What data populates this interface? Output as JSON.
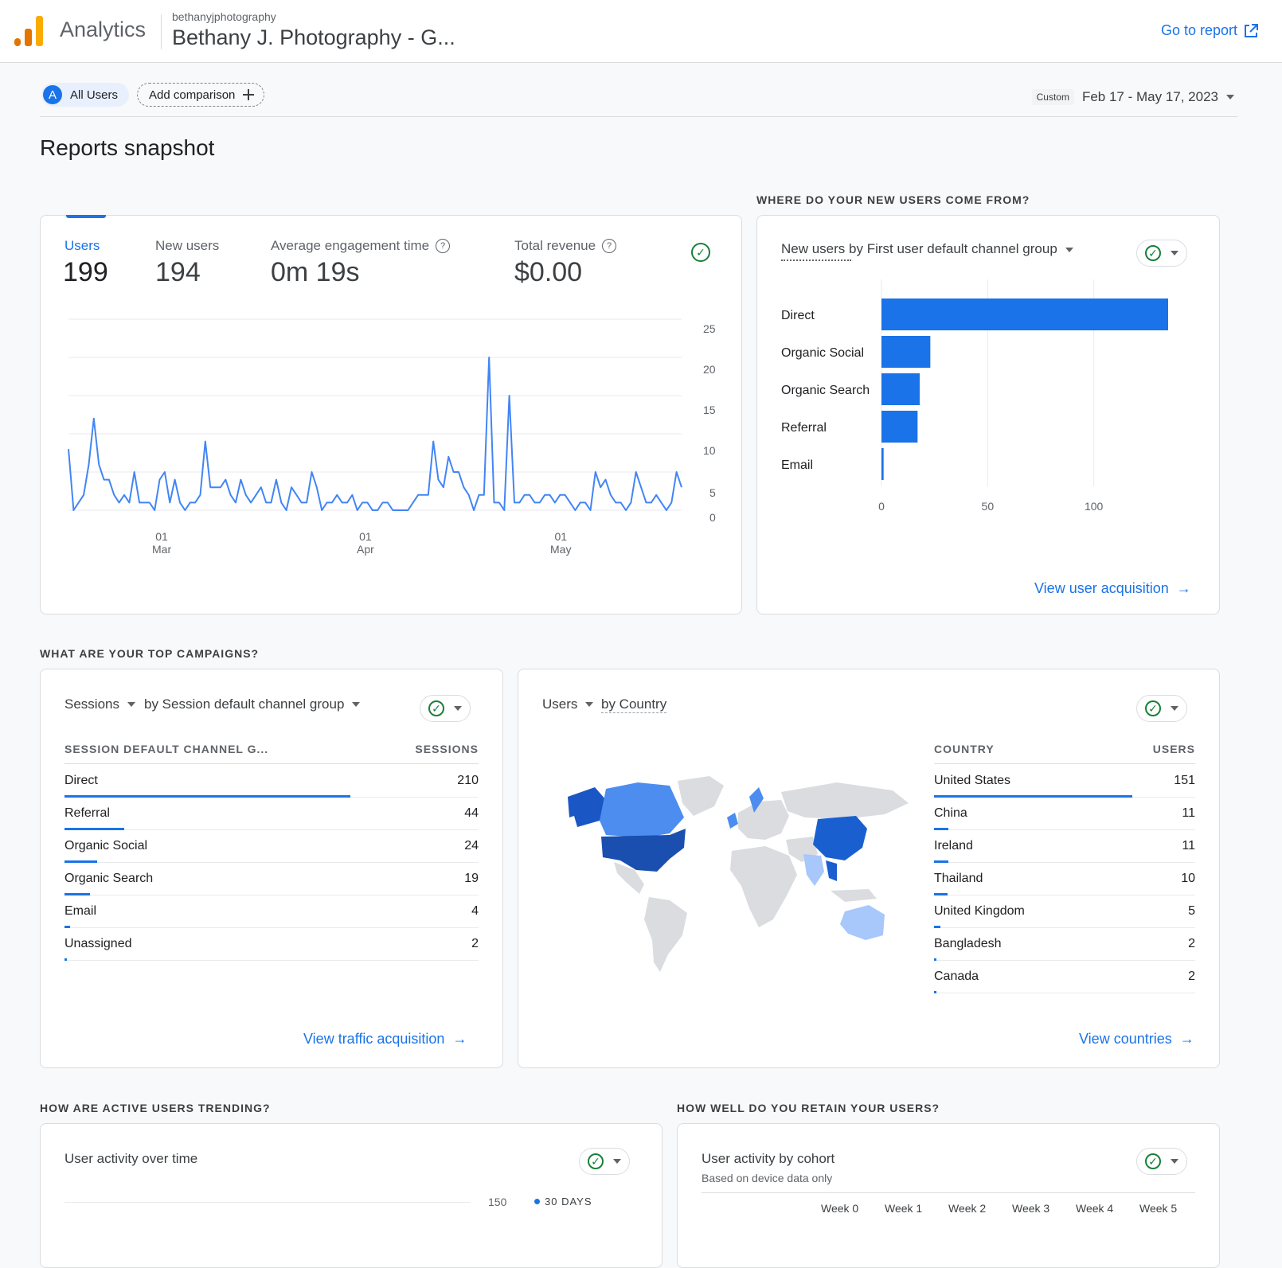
{
  "header": {
    "app_name": "Analytics",
    "account": "bethanyjphotography",
    "property": "Bethany J. Photography - G...",
    "go_to_report": "Go to report"
  },
  "toolbar": {
    "segment_initial": "A",
    "segment": "All Users",
    "add_comparison": "Add comparison",
    "date_tag": "Custom",
    "date_range": "Feb 17 - May 17, 2023"
  },
  "page_title": "Reports snapshot",
  "overview": {
    "metrics": [
      {
        "label": "Users",
        "value": "199"
      },
      {
        "label": "New users",
        "value": "194"
      },
      {
        "label": "Average engagement time",
        "value": "0m 19s"
      },
      {
        "label": "Total revenue",
        "value": "$0.00"
      }
    ],
    "y_ticks": [
      "25",
      "20",
      "15",
      "10",
      "5",
      "0"
    ],
    "x_ticks": [
      {
        "day": "01",
        "month": "Mar"
      },
      {
        "day": "01",
        "month": "Apr"
      },
      {
        "day": "01",
        "month": "May"
      }
    ]
  },
  "new_users_section": {
    "label": "WHERE DO YOUR NEW USERS COME FROM?",
    "title": "New users by First user default channel group",
    "x_ticks": [
      "0",
      "50",
      "100"
    ],
    "link": "View user acquisition"
  },
  "campaigns_section": {
    "label": "WHAT ARE YOUR TOP CAMPAIGNS?",
    "metric": "Sessions",
    "dimension": "by Session default channel group",
    "col_dim": "SESSION DEFAULT CHANNEL G...",
    "col_metric": "SESSIONS",
    "rows": [
      {
        "label": "Direct",
        "value": "210"
      },
      {
        "label": "Referral",
        "value": "44"
      },
      {
        "label": "Organic Social",
        "value": "24"
      },
      {
        "label": "Organic Search",
        "value": "19"
      },
      {
        "label": "Email",
        "value": "4"
      },
      {
        "label": "Unassigned",
        "value": "2"
      }
    ],
    "link": "View traffic acquisition"
  },
  "country_card": {
    "metric": "Users",
    "dimension": "by Country",
    "col_dim": "COUNTRY",
    "col_metric": "USERS",
    "rows": [
      {
        "label": "United States",
        "value": "151"
      },
      {
        "label": "China",
        "value": "11"
      },
      {
        "label": "Ireland",
        "value": "11"
      },
      {
        "label": "Thailand",
        "value": "10"
      },
      {
        "label": "United Kingdom",
        "value": "5"
      },
      {
        "label": "Bangladesh",
        "value": "2"
      },
      {
        "label": "Canada",
        "value": "2"
      }
    ],
    "link": "View countries"
  },
  "active_section": {
    "label": "HOW ARE ACTIVE USERS TRENDING?",
    "title": "User activity over time",
    "tick": "150",
    "legend": "30 DAYS"
  },
  "retention_section": {
    "label": "HOW WELL DO YOU RETAIN YOUR USERS?",
    "title": "User activity by cohort",
    "subtitle": "Based on device data only",
    "weeks": [
      "Week 0",
      "Week 1",
      "Week 2",
      "Week 3",
      "Week 4",
      "Week 5"
    ]
  },
  "colors": {
    "accent": "#1a73e8",
    "bar": "#1a73e8",
    "line": "#4285f4",
    "check": "#188038"
  },
  "chart_data": [
    {
      "type": "line",
      "title": "",
      "series": [
        {
          "name": "Users",
          "values": [
            8,
            0,
            1,
            2,
            6,
            12,
            6,
            4,
            4,
            2,
            1,
            2,
            1,
            5,
            1,
            1,
            1,
            0,
            4,
            5,
            1,
            4,
            1,
            0,
            1,
            1,
            2,
            9,
            3,
            3,
            3,
            4,
            2,
            1,
            4,
            2,
            1,
            2,
            3,
            1,
            1,
            4,
            1,
            0,
            3,
            2,
            1,
            1,
            5,
            3,
            0,
            1,
            1,
            2,
            1,
            1,
            2,
            0,
            1,
            1,
            0,
            0,
            1,
            1,
            0,
            0,
            0,
            0,
            1,
            2,
            2,
            2,
            9,
            4,
            3,
            7,
            5,
            5,
            3,
            2,
            0,
            2,
            2,
            20,
            1,
            1,
            0,
            15,
            1,
            1,
            2,
            2,
            1,
            1,
            2,
            2,
            1,
            2,
            2,
            1,
            0,
            1,
            1,
            0,
            5,
            3,
            4,
            2,
            1,
            1,
            0,
            1,
            5,
            3,
            1,
            1,
            2,
            1,
            0,
            1,
            5,
            3
          ]
        }
      ],
      "x_ticks": [
        "01 Mar",
        "01 Apr",
        "01 May"
      ],
      "ylim": [
        0,
        25
      ],
      "xlabel": "",
      "ylabel": ""
    },
    {
      "type": "bar",
      "orientation": "horizontal",
      "title": "New users by First user default channel group",
      "categories": [
        "Direct",
        "Organic Social",
        "Organic Search",
        "Referral",
        "Email"
      ],
      "values": [
        135,
        23,
        18,
        17,
        1
      ],
      "xlim": [
        0,
        150
      ],
      "x_ticks": [
        0,
        50,
        100
      ]
    },
    {
      "type": "table",
      "title": "",
      "categories": [
        "Direct",
        "Referral",
        "Organic Social",
        "Organic Search",
        "Email",
        "Unassigned"
      ],
      "values": [
        210,
        44,
        24,
        19,
        4,
        2
      ]
    },
    {
      "type": "table",
      "title": "",
      "categories": [
        "United States",
        "China",
        "Ireland",
        "Thailand",
        "United Kingdom",
        "Bangladesh",
        "Canada"
      ],
      "values": [
        151,
        11,
        11,
        10,
        5,
        2,
        2
      ]
    }
  ]
}
